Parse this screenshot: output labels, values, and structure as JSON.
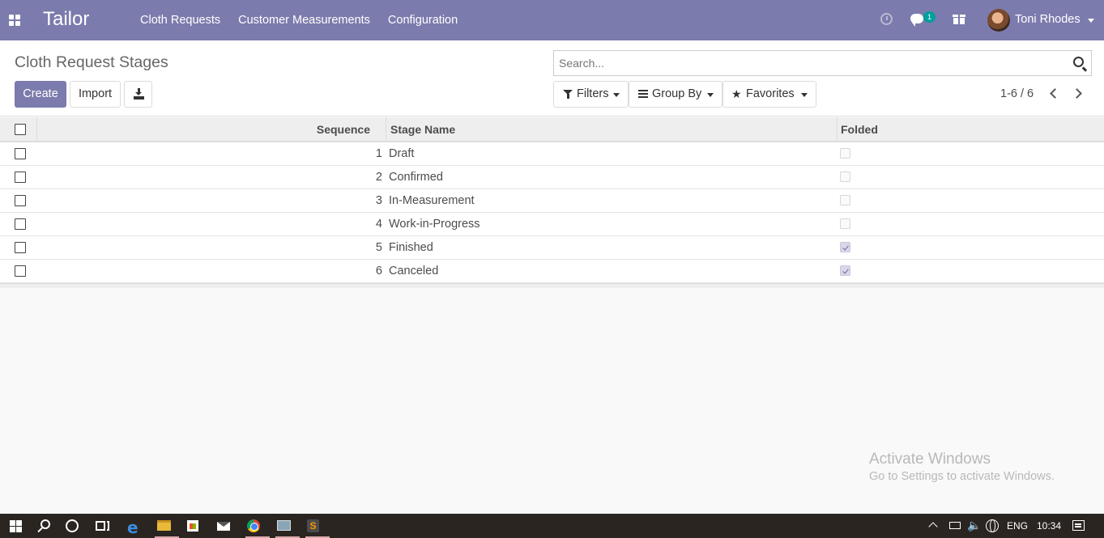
{
  "navbar": {
    "brand": "Tailor",
    "menu": [
      "Cloth Requests",
      "Customer Measurements",
      "Configuration"
    ],
    "chat_badge": "1",
    "user_name": "Toni Rhodes",
    "color": "#7c7bad"
  },
  "control_panel": {
    "title": "Cloth Request Stages",
    "create_label": "Create",
    "import_label": "Import",
    "search_placeholder": "Search...",
    "filters_label": "Filters",
    "group_by_label": "Group By",
    "favorites_label": "Favorites",
    "pager_value": "1-6 / 6"
  },
  "table": {
    "columns": [
      "Sequence",
      "Stage Name",
      "Folded"
    ],
    "rows": [
      {
        "sequence": "1",
        "name": "Draft",
        "folded": false
      },
      {
        "sequence": "2",
        "name": "Confirmed",
        "folded": false
      },
      {
        "sequence": "3",
        "name": "In-Measurement",
        "folded": false
      },
      {
        "sequence": "4",
        "name": "Work-in-Progress",
        "folded": false
      },
      {
        "sequence": "5",
        "name": "Finished",
        "folded": true
      },
      {
        "sequence": "6",
        "name": "Canceled",
        "folded": true
      }
    ]
  },
  "watermark": {
    "title": "Activate Windows",
    "subtitle": "Go to Settings to activate Windows."
  },
  "taskbar": {
    "language": "ENG",
    "time": "10:34",
    "apps": [
      "start-icon",
      "search-icon",
      "cortana-icon",
      "task-view-icon",
      "edge-icon",
      "file-explorer-icon",
      "store-icon",
      "mail-icon",
      "chrome-icon",
      "photos-icon",
      "sublime-text-icon"
    ]
  }
}
